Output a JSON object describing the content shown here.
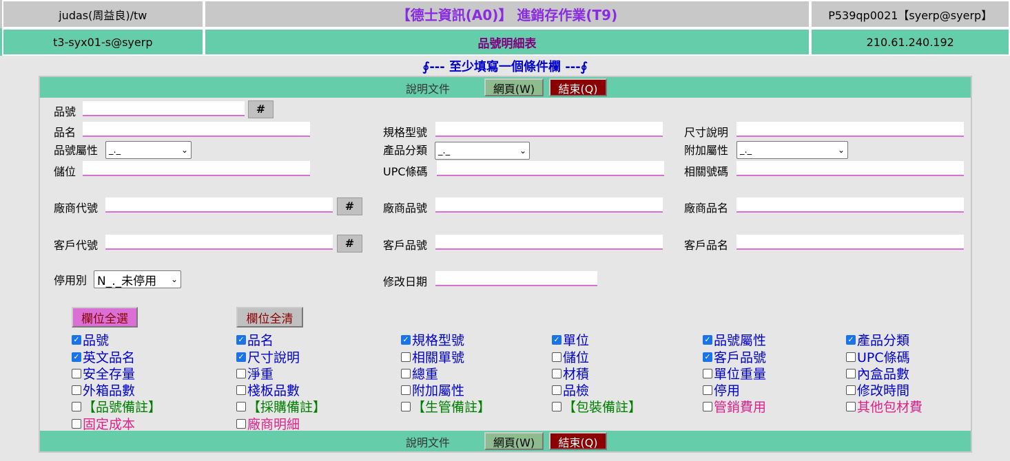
{
  "header": {
    "user": "judas(周益良)/tw",
    "title": "【德士資訊(A0)】 進銷存作業(T9)",
    "program": "P539qp0021【syerp@syerp】",
    "login": "t3-syx01-s@syerp",
    "subtitle": "品號明細表",
    "ip": "210.61.240.192"
  },
  "notice": "∮--- 至少填寫一個條件欄 ---∮",
  "toolbar": {
    "doc_label": "說明文件",
    "web_label": "網頁(W)",
    "end_label": "結束(Q)"
  },
  "form": {
    "item_no": "品號",
    "item_name": "品名",
    "spec": "規格型號",
    "size_desc": "尺寸說明",
    "item_attr": "品號屬性",
    "item_attr_value": "_._",
    "category": "產品分類",
    "category_value": "_._",
    "extra_attr": "附加屬性",
    "extra_attr_value": "_._",
    "location": "儲位",
    "upc": "UPC條碼",
    "related_no": "相關號碼",
    "vendor_code": "廠商代號",
    "vendor_item_no": "廠商品號",
    "vendor_item_name": "廠商品名",
    "customer_code": "客戶代號",
    "customer_item_no": "客戶品號",
    "customer_item_name": "客戶品名",
    "disabled": "停用別",
    "disabled_value": "N_._未停用",
    "modified_date": "修改日期",
    "hash_label": "#"
  },
  "columns": {
    "select_all": "欄位全選",
    "clear_all": "欄位全清",
    "fields": [
      {
        "label": "品號",
        "checked": true,
        "color": "#0000cd"
      },
      {
        "label": "品名",
        "checked": true,
        "color": "#0000cd"
      },
      {
        "label": "規格型號",
        "checked": true,
        "color": "#0000cd"
      },
      {
        "label": "單位",
        "checked": true,
        "color": "#0000cd"
      },
      {
        "label": "品號屬性",
        "checked": true,
        "color": "#0000cd"
      },
      {
        "label": "產品分類",
        "checked": true,
        "color": "#0000cd"
      },
      {
        "label": "英文品名",
        "checked": true,
        "color": "#0000cd"
      },
      {
        "label": "尺寸說明",
        "checked": true,
        "color": "#0000cd"
      },
      {
        "label": "相關單號",
        "checked": false,
        "color": "#0000cd"
      },
      {
        "label": "儲位",
        "checked": false,
        "color": "#0000cd"
      },
      {
        "label": "客戶品號",
        "checked": true,
        "color": "#0000cd"
      },
      {
        "label": "UPC條碼",
        "checked": false,
        "color": "#0000cd"
      },
      {
        "label": "安全存量",
        "checked": false,
        "color": "#0000cd"
      },
      {
        "label": "淨重",
        "checked": false,
        "color": "#0000cd"
      },
      {
        "label": "總重",
        "checked": false,
        "color": "#0000cd"
      },
      {
        "label": "材積",
        "checked": false,
        "color": "#0000cd"
      },
      {
        "label": "單位重量",
        "checked": false,
        "color": "#0000cd"
      },
      {
        "label": "內盒品數",
        "checked": false,
        "color": "#0000cd"
      },
      {
        "label": "外箱品數",
        "checked": false,
        "color": "#0000cd"
      },
      {
        "label": "棧板品數",
        "checked": false,
        "color": "#0000cd"
      },
      {
        "label": "附加屬性",
        "checked": false,
        "color": "#0000cd"
      },
      {
        "label": "品檢",
        "checked": false,
        "color": "#0000cd"
      },
      {
        "label": "停用",
        "checked": false,
        "color": "#0000cd"
      },
      {
        "label": "修改時間",
        "checked": false,
        "color": "#0000cd"
      },
      {
        "label": "【品號備註】",
        "checked": false,
        "color": "#008000"
      },
      {
        "label": "【採購備註】",
        "checked": false,
        "color": "#008000"
      },
      {
        "label": "【生管備註】",
        "checked": false,
        "color": "#008000"
      },
      {
        "label": "【包裝備註】",
        "checked": false,
        "color": "#008000"
      },
      {
        "label": "管銷費用",
        "checked": false,
        "color": "#e0218a"
      },
      {
        "label": "其他包材費",
        "checked": false,
        "color": "#e0218a"
      },
      {
        "label": "固定成本",
        "checked": false,
        "color": "#e0218a"
      },
      {
        "label": "廠商明細",
        "checked": false,
        "color": "#e0218a"
      }
    ]
  }
}
